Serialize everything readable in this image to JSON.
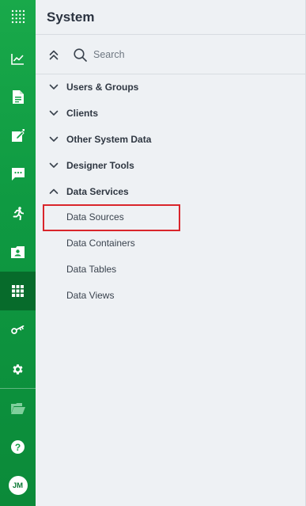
{
  "panel": {
    "title": "System",
    "search_placeholder": "Search"
  },
  "tree": {
    "groups": [
      {
        "label": "Users & Groups",
        "expanded": false
      },
      {
        "label": "Clients",
        "expanded": false
      },
      {
        "label": "Other System Data",
        "expanded": false
      },
      {
        "label": "Designer Tools",
        "expanded": false
      },
      {
        "label": "Data Services",
        "expanded": true
      }
    ],
    "children": [
      {
        "label": "Data Sources",
        "highlighted": true
      },
      {
        "label": "Data Containers",
        "highlighted": false
      },
      {
        "label": "Data Tables",
        "highlighted": false
      },
      {
        "label": "Data Views",
        "highlighted": false
      }
    ]
  },
  "rail": {
    "items": [
      {
        "icon": "apps-grid-icon",
        "active": false
      },
      {
        "icon": "chart-line-icon",
        "active": false
      },
      {
        "icon": "document-icon",
        "active": false
      },
      {
        "icon": "edit-document-icon",
        "active": false
      },
      {
        "icon": "chat-icon",
        "active": false
      },
      {
        "icon": "running-person-icon",
        "active": false
      },
      {
        "icon": "contact-folder-icon",
        "active": false
      },
      {
        "icon": "grid-icon",
        "active": true
      },
      {
        "icon": "key-icon",
        "active": false
      },
      {
        "icon": "gear-icon",
        "active": false
      },
      {
        "icon": "folder-open-icon",
        "active": false
      },
      {
        "icon": "help-icon",
        "active": false
      }
    ],
    "avatar_initials": "JM"
  },
  "colors": {
    "rail_green": "#12a045",
    "rail_active": "#076b2b",
    "highlight_red": "#d9252b",
    "panel_bg": "#eef1f4"
  }
}
